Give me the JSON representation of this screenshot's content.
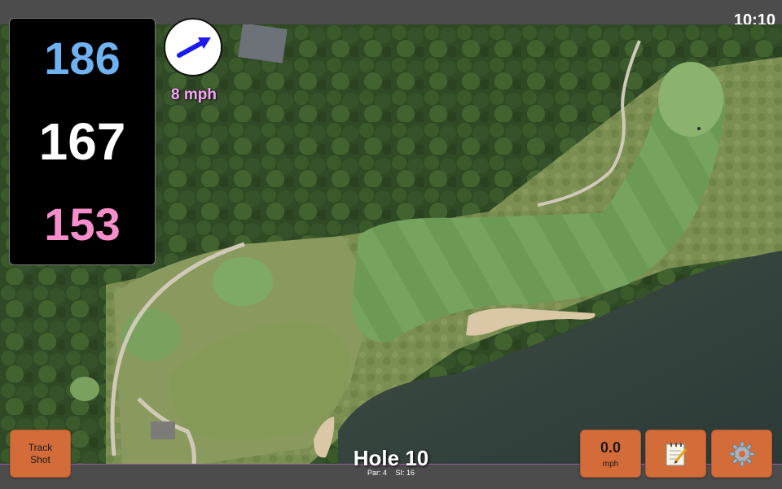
{
  "status_bar": {
    "time": "10:10"
  },
  "distances": {
    "back": "186",
    "middle": "167",
    "front": "153"
  },
  "wind": {
    "speed": "8 mph",
    "direction": "east-northeast"
  },
  "track_shot": {
    "line1": "Track",
    "line2": "Shot"
  },
  "speed_button": {
    "value": "0.0",
    "unit": "mph"
  },
  "notes_button": {
    "icon": "notepad-icon"
  },
  "settings_button": {
    "icon": "gear-icon"
  },
  "hole": {
    "title": "Hole 10",
    "par": "Par: 4",
    "si": "SI: 16"
  },
  "colors": {
    "back_distance": "#6fb2f2",
    "middle_distance": "#ffffff",
    "front_distance": "#f78ecc",
    "button": "#d46c3a",
    "wind_text": "#f2a7f2",
    "arrow": "#1a1aee"
  }
}
